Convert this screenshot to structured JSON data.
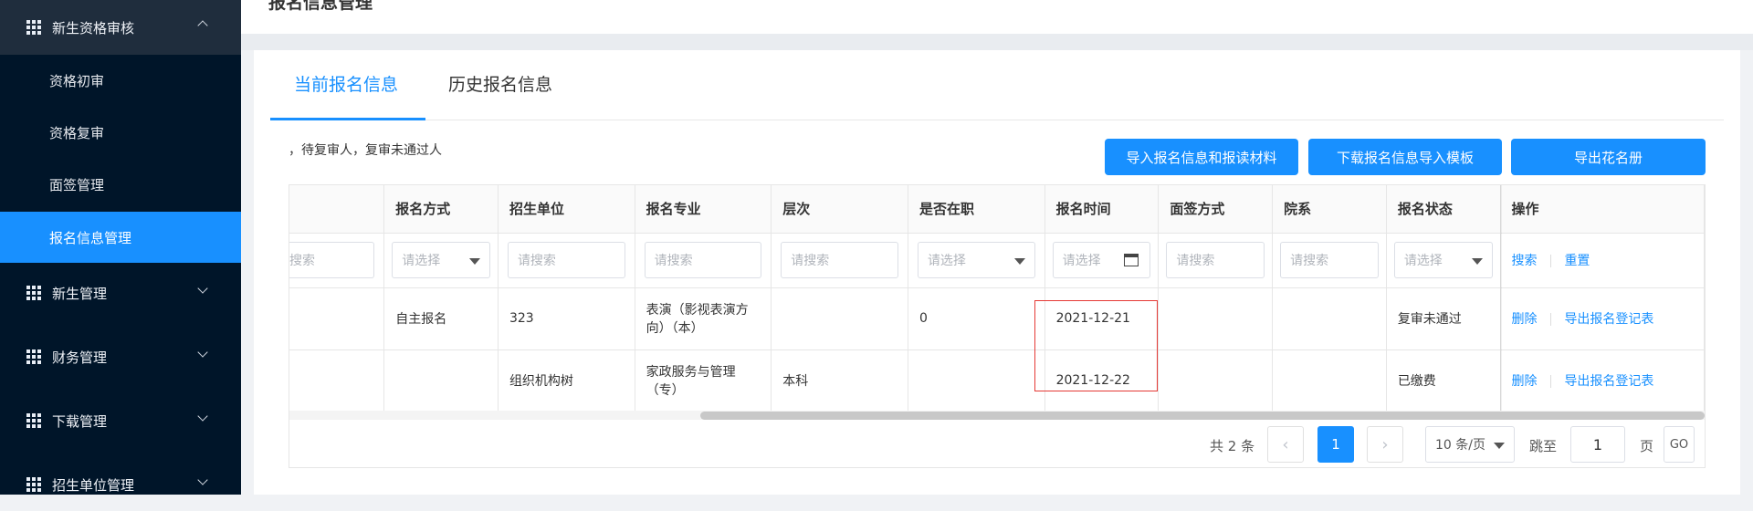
{
  "sidebar": {
    "groups": [
      {
        "label": "新生资格审核",
        "expanded": true
      },
      {
        "label": "新生管理",
        "expanded": false
      },
      {
        "label": "财务管理",
        "expanded": false
      },
      {
        "label": "下载管理",
        "expanded": false
      },
      {
        "label": "招生单位管理",
        "expanded": false
      }
    ],
    "sub_items": [
      "资格初审",
      "资格复审",
      "面签管理",
      "报名信息管理"
    ],
    "active_sub_item": "报名信息管理"
  },
  "page": {
    "title": "报名信息管理"
  },
  "tabs": [
    {
      "label": "当前报名信息",
      "active": true
    },
    {
      "label": "历史报名信息",
      "active": false
    }
  ],
  "hint_text": "，待复审人，复审未通过人",
  "toolbar": {
    "import_label": "导入报名信息和报读材料",
    "download_template_label": "下载报名信息导入模板",
    "export_label": "导出花名册"
  },
  "table": {
    "columns": [
      "",
      "报名方式",
      "招生单位",
      "报名专业",
      "层次",
      "是否在职",
      "报名时间",
      "面签方式",
      "院系",
      "报名状态",
      "操作"
    ],
    "filters": {
      "col0_partial": "搜索",
      "select_placeholder": "请选择",
      "search_placeholder": "请搜索",
      "search_link": "搜索",
      "reset_link": "重置"
    },
    "rows": [
      {
        "method": "自主报名",
        "unit": "323",
        "major": "表演（影视表演方向）（本）",
        "level": "",
        "employed": "0",
        "date": "2021-12-21",
        "interview": "",
        "dept": "",
        "status": "复审未通过"
      },
      {
        "method": "",
        "unit": "组织机构树",
        "major": "家政服务与管理（专）",
        "level": "本科",
        "employed": "",
        "date": "2021-12-22",
        "interview": "",
        "dept": "",
        "status": "已缴费"
      }
    ],
    "row_actions": {
      "delete": "删除",
      "export_form": "导出报名登记表"
    }
  },
  "pagination": {
    "total_text": "共 2 条",
    "current_page": "1",
    "page_size": "10 条/页",
    "jump_label": "跳至",
    "jump_value": "1",
    "page_unit": "页",
    "go_label": "GO",
    "prev_icon": "‹",
    "next_icon": "›"
  },
  "colors": {
    "sidebar_bg": "#001529",
    "accent": "#1890ff",
    "highlight_box": "#e53935"
  }
}
